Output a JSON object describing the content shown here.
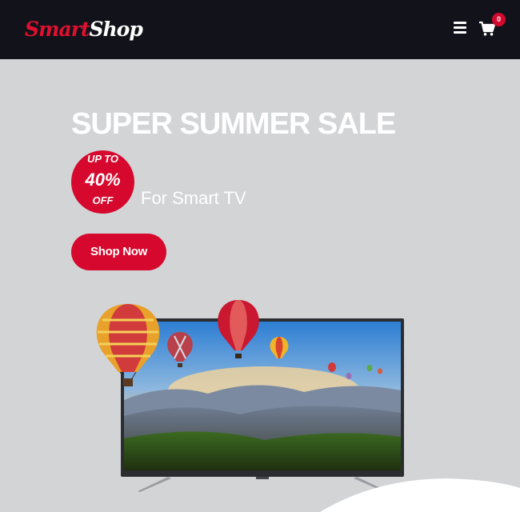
{
  "header": {
    "logo_part1": "Smart",
    "logo_part2": "Shop",
    "menu_icon": "hamburger-menu-icon",
    "cart_icon": "shopping-cart-icon",
    "cart_count": "0"
  },
  "hero": {
    "title": "SUPER SUMMER SALE",
    "badge_line1": "UP TO",
    "badge_line2": "40%",
    "badge_line3": "OFF",
    "subtitle": "For Smart TV",
    "cta_label": "Shop Now",
    "image_description_icon": "smart-tv-with-hot-air-balloons-image"
  },
  "colors": {
    "header_bg": "#12131a",
    "hero_bg": "#d3d4d6",
    "accent": "#d6082d",
    "text_light": "#ffffff"
  }
}
